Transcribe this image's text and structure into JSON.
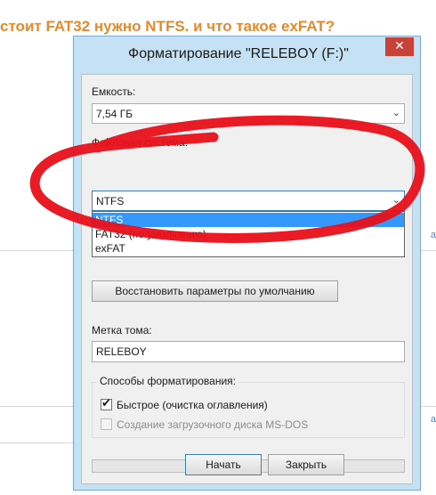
{
  "background": {
    "heading": "стоит FAT32 нужно NTFS. и что такое exFAT?"
  },
  "dialog": {
    "title": "Форматирование \"RELEBOY (F:)\"",
    "close_icon": "close-icon",
    "capacity": {
      "label": "Емкость:",
      "value": "7,54 ГБ"
    },
    "filesystem": {
      "label": "Файловая система:",
      "value": "NTFS",
      "options": [
        {
          "label": "NTFS",
          "selected": true
        },
        {
          "label": "FAT32 (по умолчанию)",
          "selected": false
        },
        {
          "label": "exFAT",
          "selected": false
        }
      ]
    },
    "restore_button": "Восстановить параметры по умолчанию",
    "volume_label": {
      "label": "Метка тома:",
      "value": "RELEBOY"
    },
    "format_options": {
      "legend": "Способы форматирования:",
      "quick": {
        "label": "Быстрое (очистка оглавления)",
        "checked": true,
        "enabled": true
      },
      "msdos": {
        "label": "Создание загрузочного диска MS-DOS",
        "checked": false,
        "enabled": false
      }
    },
    "progress": {
      "value": 0
    },
    "buttons": {
      "start": "Начать",
      "close": "Закрыть"
    }
  },
  "colors": {
    "heading": "#e38a2e",
    "dialog_frame": "#c5e2f4",
    "close_button": "#c7433a",
    "selection": "#3399ff",
    "annotation": "#e8101a"
  }
}
